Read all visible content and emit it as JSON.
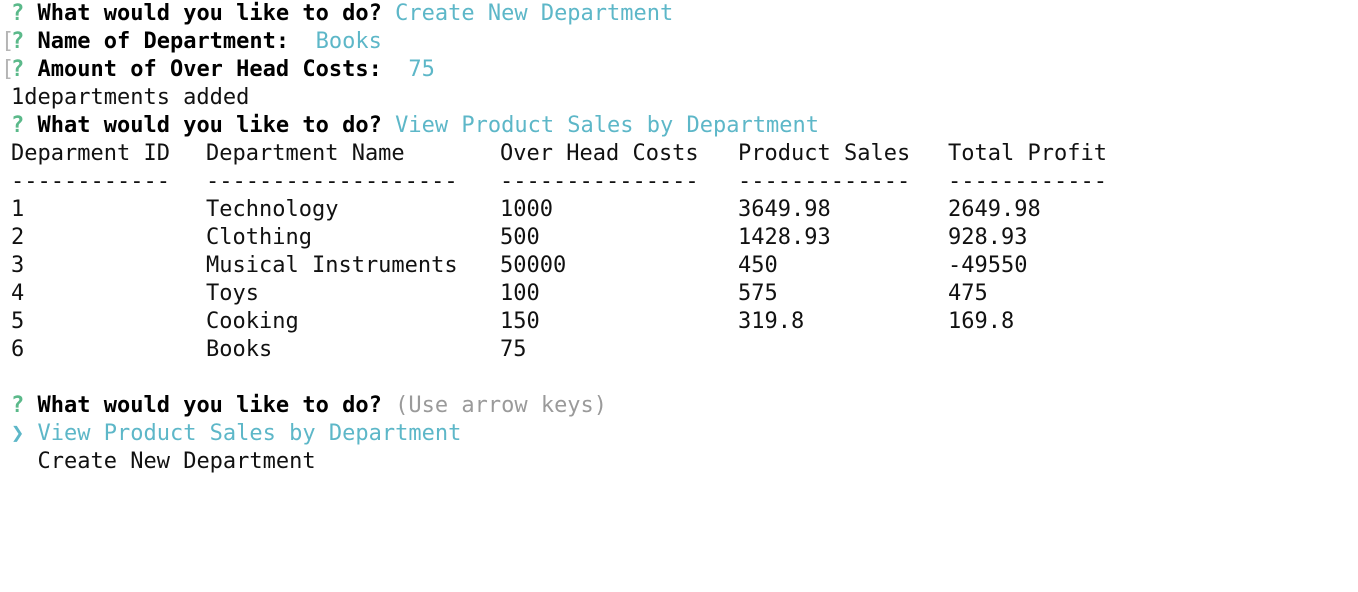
{
  "prompts": {
    "q_mark": "?",
    "bracket": "[",
    "what_do": "What would you like to do?",
    "answer1": "Create New Department",
    "dept_name_q": "Name of Department:",
    "dept_name_a": "Books",
    "overhead_q": "Amount of Over Head Costs:",
    "overhead_a": "75",
    "added_msg": "1departments added",
    "answer2": "View Product Sales by Department",
    "hint": "(Use arrow keys)"
  },
  "table": {
    "headers": [
      "Deparment ID",
      "Department Name",
      "Over Head Costs",
      "Product Sales",
      "Total Profit"
    ],
    "separators": [
      "------------",
      "-------------------",
      "---------------",
      "-------------",
      "------------"
    ],
    "rows": [
      [
        "1",
        "Technology",
        "1000",
        "3649.98",
        "2649.98"
      ],
      [
        "2",
        "Clothing",
        "500",
        "1428.93",
        "928.93"
      ],
      [
        "3",
        "Musical Instruments",
        "50000",
        "450",
        "-49550"
      ],
      [
        "4",
        "Toys",
        "100",
        "575",
        "475"
      ],
      [
        "5",
        "Cooking",
        "150",
        "319.8",
        "169.8"
      ],
      [
        "6",
        "Books",
        "75",
        "",
        ""
      ]
    ]
  },
  "menu": {
    "pointer": "❯",
    "options": [
      "View Product Sales by Department",
      "Create New Department"
    ]
  }
}
